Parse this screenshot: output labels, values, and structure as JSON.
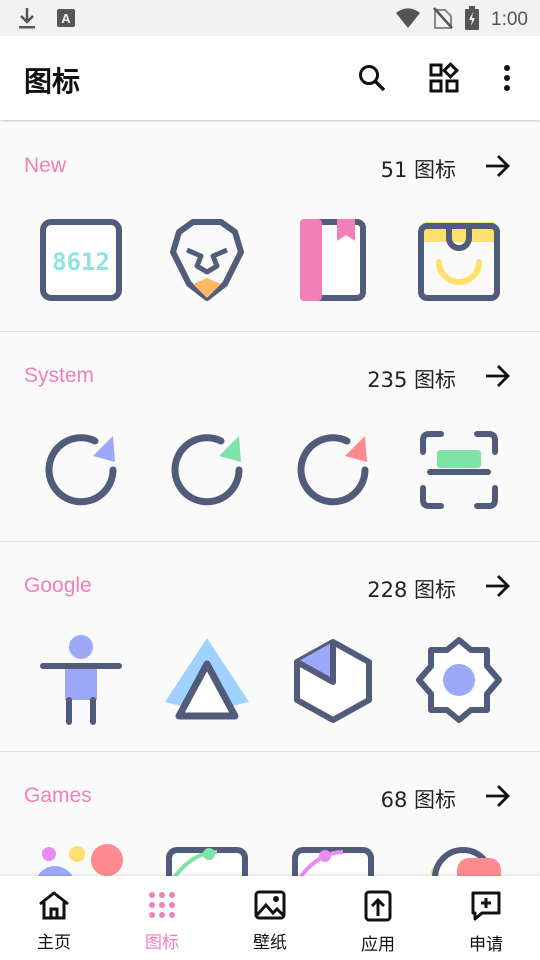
{
  "status_bar": {
    "time": "1:00",
    "notification_icons": [
      "download-icon",
      "app-a-icon"
    ],
    "system_icons": [
      "wifi-icon",
      "no-sim-icon",
      "battery-charging-icon"
    ]
  },
  "app_bar": {
    "title": "图标",
    "actions": [
      "search-icon",
      "apps-grid-icon",
      "more-vert-icon"
    ]
  },
  "sections": [
    {
      "title": "New",
      "count": "51 图标",
      "icons": [
        "box-8612-icon",
        "brave-lion-icon",
        "pink-book-icon",
        "shopping-bag-icon"
      ]
    },
    {
      "title": "System",
      "count": "235 图标",
      "icons": [
        "refresh-blue-icon",
        "refresh-green-icon",
        "refresh-red-icon",
        "scanner-icon"
      ]
    },
    {
      "title": "Google",
      "count": "228 图标",
      "icons": [
        "accessibility-icon",
        "drive-triangle-icon",
        "hexagon-pie-icon",
        "settings-gear-icon"
      ]
    },
    {
      "title": "Games",
      "count": "68 图标",
      "icons": [
        "dots-game-icon",
        "map-game-icon",
        "route-game-icon",
        "chat-bubble-game-icon"
      ]
    }
  ],
  "box_text": "8612",
  "bottom_nav": [
    {
      "label": "主页",
      "icon": "home-icon"
    },
    {
      "label": "图标",
      "icon": "dots-grid-icon",
      "active": true
    },
    {
      "label": "壁纸",
      "icon": "wallpaper-icon"
    },
    {
      "label": "应用",
      "icon": "apply-icon"
    },
    {
      "label": "申请",
      "icon": "request-icon"
    }
  ],
  "colors": {
    "accent": "#f17fb8",
    "icon_stroke": "#515c7a",
    "blue": "#9ea8f8",
    "green": "#7fe3a8",
    "red": "#ff8a8f",
    "yellow": "#ffe06d",
    "cyan": "#8ee3e6"
  }
}
